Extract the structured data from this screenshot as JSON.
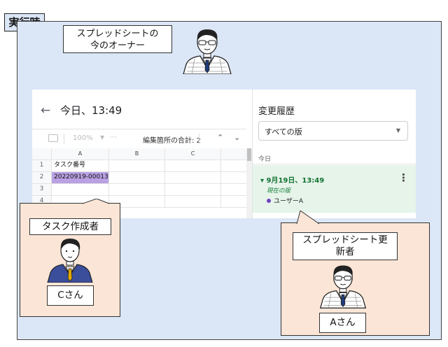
{
  "run_tag": "実行時",
  "owner_label": [
    "スプレッドシートの",
    "今のオーナー"
  ],
  "screenshot": {
    "title": "今日、13:49",
    "zoom": "100%",
    "edit_total": "編集箇所の合計: 2",
    "columns": [
      "A",
      "B",
      "C"
    ],
    "rows": [
      {
        "num": "1",
        "a": "タスク番号"
      },
      {
        "num": "2",
        "a": "20220919-00013"
      },
      {
        "num": "3",
        "a": ""
      },
      {
        "num": "4",
        "a": ""
      }
    ],
    "history": {
      "title": "変更履歴",
      "select_value": "すべての版",
      "group_label": "今日",
      "version_date": "9月19日、13:49",
      "current_version": "現在の版",
      "user": "ユーザーA"
    }
  },
  "creator_label": "タスク作成者",
  "c_name": "Cさん",
  "updater_label": [
    "スプレッドシート更",
    "新者"
  ],
  "a_name": "Aさん",
  "icons": [
    "back-arrow-icon",
    "print-icon",
    "chevron-up-icon",
    "chevron-down-icon",
    "more-vert-icon",
    "person-icon"
  ],
  "colors": {
    "panel": "#dbe6f6",
    "callout": "#fbe5d6",
    "selected_cell": "#b9a1e3",
    "version_bg": "#e6f4ea",
    "version_text": "#137333"
  }
}
